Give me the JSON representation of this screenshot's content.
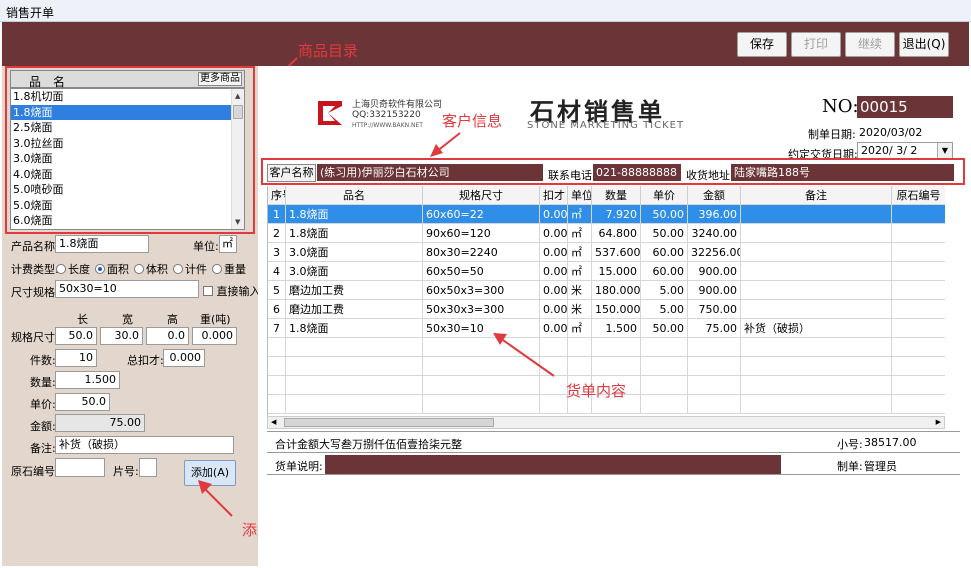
{
  "window": {
    "title": "销售开单"
  },
  "toolbar": {
    "save": "保存",
    "print": "打印",
    "continue": "继续",
    "exit": "退出(Q)"
  },
  "annotations": {
    "catalog": "商品目录",
    "customer_info": "客户信息",
    "order_content": "货单内容",
    "add_content": "添加货单内容"
  },
  "catalog": {
    "col_label": "品　名",
    "more_button": "更多商品",
    "items": [
      "1.8机切面",
      "1.8烧面",
      "2.5烧面",
      "3.0拉丝面",
      "3.0烧面",
      "4.0烧面",
      "5.0喷砂面",
      "5.0烧面",
      "6.0烧面"
    ]
  },
  "product_form": {
    "name_label": "产品名称:",
    "name_value": "1.8烧面",
    "unit_label": "单位:",
    "unit_value": "㎡",
    "billing_label": "计费类型:",
    "billing_options": [
      "长度",
      "面积",
      "体积",
      "计件",
      "重量"
    ],
    "billing_selected": "面积",
    "size_label": "尺寸规格:",
    "size_value": "50x30=10",
    "direct_input_label": "直接输入",
    "dim_headers": [
      "长",
      "宽",
      "高",
      "重(吨)"
    ],
    "dims_label": "规格尺寸:",
    "dim_values": [
      "50.0",
      "30.0",
      "0.0",
      "0.000"
    ],
    "pieces_label": "件数:",
    "pieces_value": "10",
    "deduct_label": "总扣才:",
    "deduct_value": "0.000",
    "qty_label": "数量:",
    "qty_value": "1.500",
    "price_label": "单价:",
    "price_value": "50.0",
    "amount_label": "金额:",
    "amount_value": "75.00",
    "remark_label": "备注:",
    "remark_value": "补货（破损）",
    "stone_no_label": "原石编号:",
    "stone_no_value": "",
    "slab_no_label": "片号:",
    "slab_no_value": "",
    "add_button": "添加(A)"
  },
  "header": {
    "company_name": "上海贝奇软件有限公司",
    "company_qq": "QQ:332153220",
    "company_url": "HTTP://WWW.BAKN.NET",
    "doc_title": "石材销售单",
    "doc_subtitle": "STONE MARKETING TICKET",
    "no_label": "NO:",
    "no_value": "00015",
    "date_label": "制单日期:",
    "date_value": "2020/03/02",
    "delivery_label": "约定交货日期:",
    "delivery_value": "2020/ 3/ 2"
  },
  "customer": {
    "name_button": "客户名称",
    "name_value": "(练习用)伊丽莎白石材公司",
    "phone_label": "联系电话:",
    "phone_value": "021-88888888",
    "address_label": "收货地址:",
    "address_value": "陆家嘴路188号"
  },
  "grid": {
    "columns": [
      "序号",
      "品名",
      "规格尺寸",
      "扣才",
      "单位",
      "数量",
      "单价",
      "金额",
      "备注",
      "原石编号"
    ],
    "rows": [
      [
        "1",
        "1.8烧面",
        "60x60=22",
        "0.000",
        "㎡",
        "7.920",
        "50.00",
        "396.00",
        ""
      ],
      [
        "2",
        "1.8烧面",
        "90x60=120",
        "0.000",
        "㎡",
        "64.800",
        "50.00",
        "3240.00",
        ""
      ],
      [
        "3",
        "3.0烧面",
        "80x30=2240",
        "0.000",
        "㎡",
        "537.600",
        "60.00",
        "32256.00",
        ""
      ],
      [
        "4",
        "3.0烧面",
        "60x50=50",
        "0.000",
        "㎡",
        "15.000",
        "60.00",
        "900.00",
        ""
      ],
      [
        "5",
        "磨边加工费",
        "60x50x3=300",
        "0.000",
        "米",
        "180.000",
        "5.00",
        "900.00",
        ""
      ],
      [
        "6",
        "磨边加工费",
        "50x30x3=300",
        "0.000",
        "米",
        "150.000",
        "5.00",
        "750.00",
        ""
      ],
      [
        "7",
        "1.8烧面",
        "50x30=10",
        "0.000",
        "㎡",
        "1.500",
        "50.00",
        "75.00",
        "补货（破损）"
      ]
    ],
    "selected_row": 0
  },
  "footer": {
    "total_words_label": "合计金额大写:",
    "total_words": "叁万捌仟伍佰壹拾柒元整",
    "subtotal_label": "小号:",
    "subtotal_value": "38517.00",
    "note_label": "货单说明:",
    "maker_label": "制单:",
    "maker_value": "管理员"
  },
  "colors": {
    "accent_dark": "#6b3436",
    "select_blue": "#2f8ee8",
    "annotation_red": "#e0393e"
  }
}
